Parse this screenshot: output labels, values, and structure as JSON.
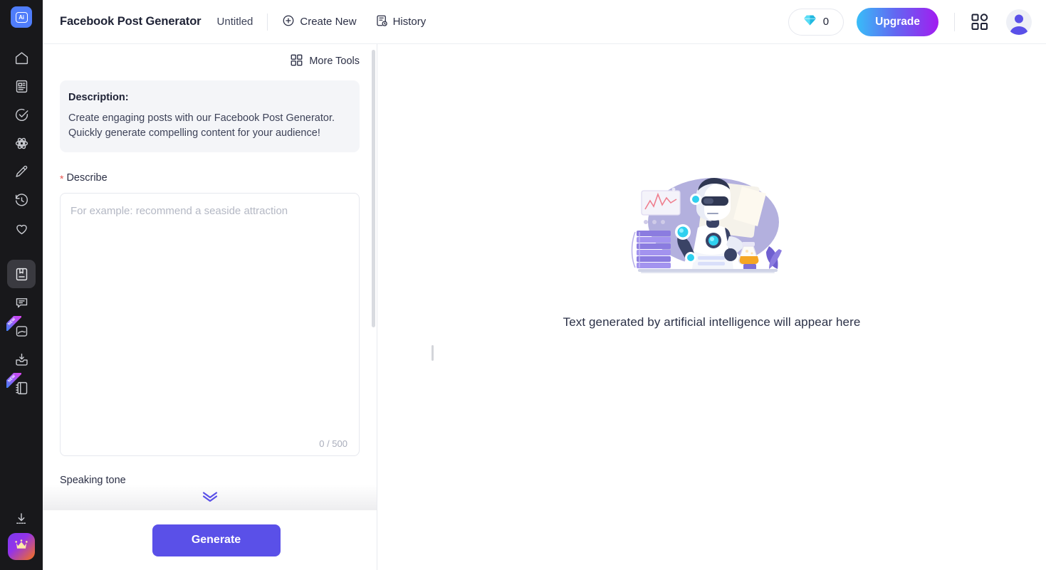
{
  "app": {
    "logo_text": "Ai",
    "logo_icon": "ai-logo-icon"
  },
  "sidebar": {
    "items": [
      {
        "icon": "home-icon",
        "name": "home",
        "active": false,
        "badge": ""
      },
      {
        "icon": "document-icon",
        "name": "documents",
        "active": false,
        "badge": ""
      },
      {
        "icon": "check-circle-icon",
        "name": "tasks",
        "active": false,
        "badge": ""
      },
      {
        "icon": "atom-icon",
        "name": "ai-lab",
        "active": false,
        "badge": ""
      },
      {
        "icon": "pencil-icon",
        "name": "write",
        "active": false,
        "badge": ""
      },
      {
        "icon": "history-clock-icon",
        "name": "history",
        "active": false,
        "badge": ""
      },
      {
        "icon": "heart-icon",
        "name": "favorites",
        "active": false,
        "badge": ""
      },
      {
        "icon": "book-icon",
        "name": "library",
        "active": true,
        "badge": ""
      },
      {
        "icon": "chat-bubble-icon",
        "name": "chat",
        "active": false,
        "badge": ""
      },
      {
        "icon": "image-icon",
        "name": "images",
        "active": false,
        "badge": "NEW"
      },
      {
        "icon": "inbox-download-icon",
        "name": "downloads",
        "active": false,
        "badge": ""
      },
      {
        "icon": "notebook-icon",
        "name": "notebook",
        "active": false,
        "badge": "NEW"
      }
    ],
    "bottom": [
      {
        "icon": "download-icon",
        "name": "install-app",
        "badge": ""
      },
      {
        "icon": "crown-icon",
        "name": "premium",
        "badge": ""
      }
    ]
  },
  "header": {
    "title": "Facebook Post Generator",
    "doc_name": "Untitled",
    "create_new_label": "Create New",
    "create_new_icon": "plus-circle-icon",
    "history_label": "History",
    "history_icon": "history-doc-icon",
    "credits_value": "0",
    "credits_icon": "diamond-icon",
    "upgrade_label": "Upgrade",
    "apps_icon": "grid-apps-icon",
    "avatar_icon": "user-avatar-icon"
  },
  "form": {
    "more_tools_label": "More Tools",
    "more_tools_icon": "grid-tools-icon",
    "description_title": "Description:",
    "description_text": "Create engaging posts with our Facebook Post Generator. Quickly generate compelling content for your audience!",
    "describe_label": "Describe",
    "required_marker": "*",
    "describe_value": "",
    "describe_placeholder": "For example: recommend a seaside attraction",
    "counter": "0 / 500",
    "speaking_tone_label": "Speaking tone",
    "expand_icon": "double-chevron-down-icon",
    "generate_label": "Generate"
  },
  "output": {
    "illustration": "robot-reading-illustration",
    "empty_text": "Text generated by artificial intelligence will appear here"
  },
  "colors": {
    "rail_bg": "#18181b",
    "accent": "#5a50e8",
    "upgrade_from": "#38bdf8",
    "upgrade_to": "#a21cf0",
    "required_red": "#e8554f",
    "desc_bg": "#f4f5f8"
  }
}
